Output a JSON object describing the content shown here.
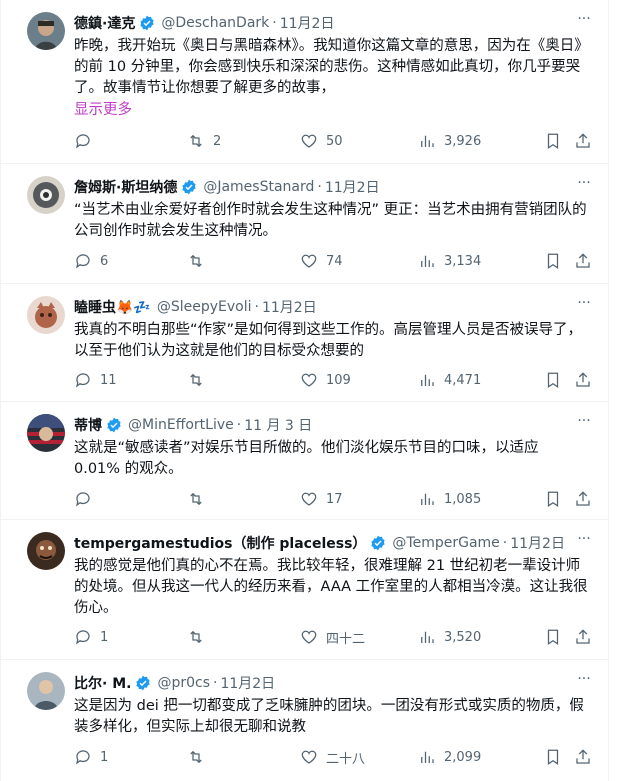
{
  "colors": {
    "accent": "#1d9bf0",
    "link": "#c13cc7",
    "muted": "#536471",
    "text": "#0f1419"
  },
  "tweets": [
    {
      "name": "德鎮·達克",
      "handle": "@DeschanDark",
      "dot": "·",
      "time": "11月2日",
      "text": "昨晚，我开始玩《奥日与黑暗森林》。我知道你这篇文章的意思，因为在《奥日》的前 10 分钟里，你会感到快乐和深深的悲伤。这种情感如此真切，你几乎要哭了。故事情节让你想要了解更多的故事，",
      "show_more": "显示更多",
      "replies": "",
      "retweets": "2",
      "likes": "50",
      "views": "3,926"
    },
    {
      "name": "詹姆斯·斯坦纳德",
      "handle": "@JamesStanard",
      "dot": "·",
      "time": "11月2日",
      "text": "“当艺术由业余爱好者创作时就会发生这种情况” 更正：当艺术由拥有营销团队的公司创作时就会发生这种情况。",
      "replies": "6",
      "retweets": "",
      "likes": "74",
      "views": "3,134"
    },
    {
      "name": "瞌睡虫🦊💤",
      "handle": "@SleepyEvoli",
      "dot": "·",
      "time": "11月2日",
      "text": "我真的不明白那些“作家”是如何得到这些工作的。高层管理人员是否被误导了，以至于他们认为这就是他们的目标受众想要的",
      "replies": "11",
      "retweets": "",
      "likes": "109",
      "views": "4,471"
    },
    {
      "name": "蒂博",
      "handle": "@MinEffortLive",
      "dot": "·",
      "time": "11 月 3 日",
      "text": "这就是“敏感读者”对娱乐节目所做的。他们淡化娱乐节目的口味，以适应 0.01% 的观众。",
      "replies": "",
      "retweets": "",
      "likes": "17",
      "views": "1,085"
    },
    {
      "name": "tempergamestudios（制作 placeless）",
      "handle": "@TemperGame",
      "dot": "·",
      "time": "11月2日",
      "text": "我的感觉是他们真的心不在焉。我比较年轻，很难理解 21 世纪初老一辈设计师的处境。但从我这一代人的经历来看，AAA 工作室里的人都相当冷漠。这让我很伤心。",
      "replies": "1",
      "retweets": "",
      "likes": "四十二",
      "views": "3,520"
    },
    {
      "name": "比尔· M.",
      "handle": "@pr0cs",
      "dot": "·",
      "time": "11月2日",
      "text": "这是因为 dei 把一切都变成了乏味臃肿的团块。一团没有形式或实质的物质，假装多样化，但实际上却很无聊和说教",
      "replies": "1",
      "retweets": "",
      "likes": "二十八",
      "views": "2,099"
    }
  ]
}
